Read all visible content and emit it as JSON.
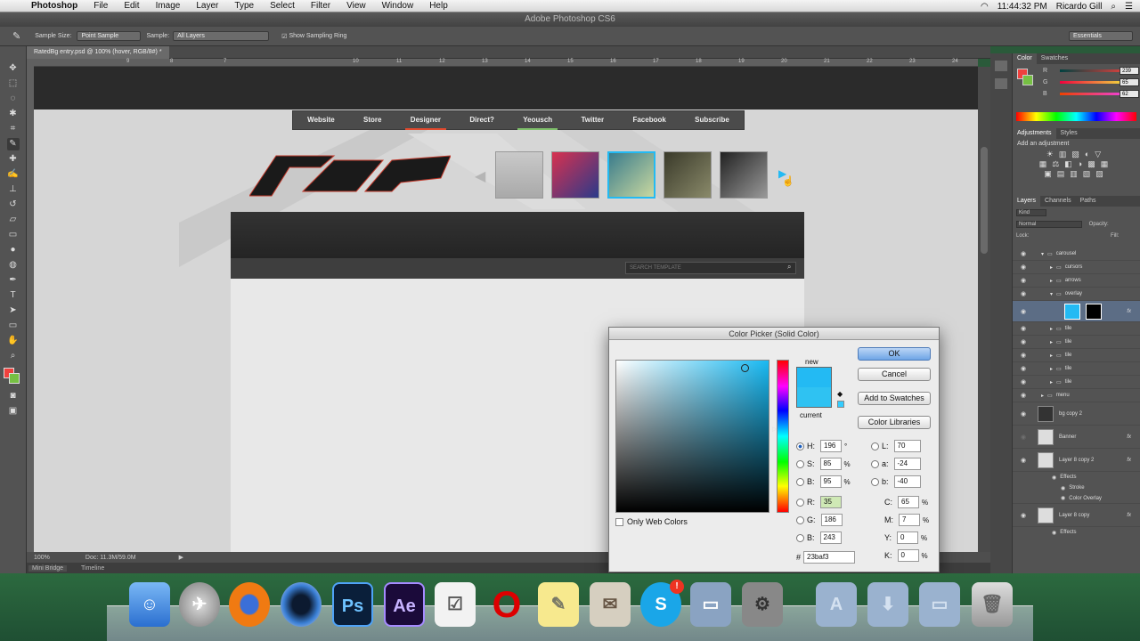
{
  "menubar": {
    "app": "Photoshop",
    "items": [
      "File",
      "Edit",
      "Image",
      "Layer",
      "Type",
      "Select",
      "Filter",
      "View",
      "Window",
      "Help"
    ],
    "time": "11:44:32 PM",
    "user": "Ricardo Gill"
  },
  "window_title": "Adobe Photoshop CS6",
  "options": {
    "sample_size_label": "Sample Size:",
    "sample_size_value": "Point Sample",
    "sample_label": "Sample:",
    "sample_value": "All Layers",
    "sampling_ring": "Show Sampling Ring",
    "workspace": "Essentials"
  },
  "document": {
    "tab": "RatedBg entry.psd @ 100% (hover, RGB/8#) *",
    "zoom": "100%",
    "doc_size": "Doc: 11.3M/59.0M",
    "ruler_ticks": [
      "9",
      "8",
      "7",
      "10",
      "11",
      "12",
      "13",
      "14",
      "15",
      "16",
      "17",
      "18",
      "19",
      "20",
      "21",
      "22",
      "23",
      "24"
    ]
  },
  "mini_bridge": {
    "tabs": [
      "Mini Bridge",
      "Timeline"
    ]
  },
  "website": {
    "nav": [
      "Website",
      "Store",
      "Designer",
      "Direct?",
      "Yeousch",
      "Twitter",
      "Facebook",
      "Subscribe"
    ],
    "search_placeholder": "SEARCH TEMPLATE"
  },
  "color_panel": {
    "tabs": [
      "Color",
      "Swatches"
    ],
    "r": "239",
    "g": "65",
    "b": "62",
    "labels": [
      "R",
      "G",
      "B"
    ]
  },
  "adjustments": {
    "tabs": [
      "Adjustments",
      "Styles"
    ],
    "title": "Add an adjustment"
  },
  "layers_panel": {
    "tabs": [
      "Layers",
      "Channels",
      "Paths"
    ],
    "filter": "Kind",
    "blend": "Normal",
    "opacity_label": "Opacity:",
    "lock_label": "Lock:",
    "fill_label": "Fill:",
    "layers": [
      "carousel",
      "cursors",
      "arrows",
      "overlay",
      "",
      "tile",
      "tile",
      "tile",
      "tile",
      "tile",
      "menu",
      "bg copy 2",
      "Banner",
      "Layer 8 copy 2",
      "Effects",
      "Stroke",
      "Color Overlay",
      "Layer 8 copy",
      "Effects"
    ]
  },
  "color_picker": {
    "title": "Color Picker (Solid Color)",
    "ok": "OK",
    "cancel": "Cancel",
    "add_swatches": "Add to Swatches",
    "color_libraries": "Color Libraries",
    "new_label": "new",
    "current_label": "current",
    "only_web": "Only Web Colors",
    "h": "196",
    "s": "85",
    "b_hsb": "95",
    "r": "35",
    "g": "186",
    "b": "243",
    "l": "70",
    "a": "-24",
    "b_lab": "-40",
    "c": "65",
    "m": "7",
    "y": "0",
    "k": "0",
    "hex": "23baf3",
    "h_unit": "°",
    "pct": "%",
    "hash": "#",
    "labels": {
      "H": "H:",
      "S": "S:",
      "B": "B:",
      "R": "R:",
      "G": "G:",
      "Bb": "B:",
      "L": "L:",
      "a": "a:",
      "b": "b:",
      "C": "C:",
      "M": "M:",
      "Y": "Y:",
      "K": "K:"
    },
    "new_color": "#23baf3",
    "current_color": "#2fc2f2"
  },
  "dock": {
    "ps_label": "Ps",
    "ae_label": "Ae",
    "badge": "!"
  }
}
